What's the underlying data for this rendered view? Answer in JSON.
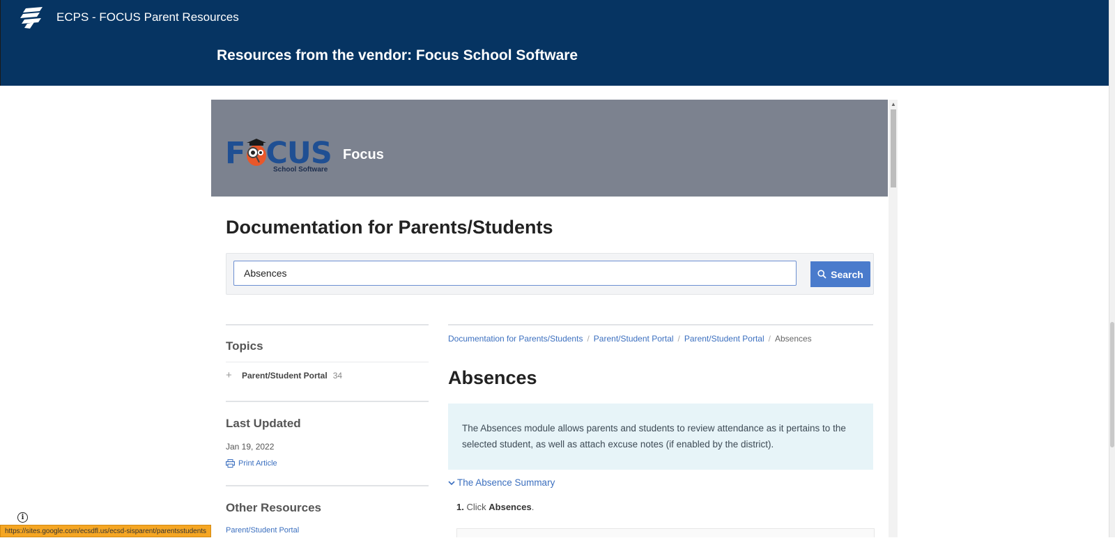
{
  "site": {
    "title": "ECPS - FOCUS Parent Resources",
    "heading": "Resources from the vendor: Focus School Software"
  },
  "focus": {
    "logo_word": "F   CUS",
    "logo_sub": "School Software",
    "name": "Focus"
  },
  "doc": {
    "title": "Documentation for Parents/Students"
  },
  "search": {
    "value": "Absences",
    "button_label": "Search"
  },
  "sidebar": {
    "topics_heading": "Topics",
    "topics": [
      {
        "label": "Parent/Student Portal",
        "count": "34"
      }
    ],
    "last_updated_heading": "Last Updated",
    "last_updated_date": "Jan 19, 2022",
    "print_label": "Print Article",
    "other_heading": "Other Resources",
    "other_link": "Parent/Student Portal"
  },
  "breadcrumb": [
    "Documentation for Parents/Students",
    "Parent/Student Portal",
    "Parent/Student Portal",
    "Absences"
  ],
  "article": {
    "title": "Absences",
    "intro": "The Absences module allows parents and students to review attendance as it pertains to the selected student, as well as attach excuse notes (if enabled by the district).",
    "section_label": "The Absence Summary",
    "step_number": "1.",
    "step_text": "Click",
    "step_bold": "Absences",
    "step_end": "."
  },
  "status_url": "https://sites.google.com/ecsdfl.us/ecsd-sisparent/parentsstudents",
  "colors": {
    "header_bg": "#063462",
    "banner_bg": "#7c828f",
    "accent": "#4a7bcc",
    "link": "#3b6fbf",
    "info_bg": "#e7f4f8"
  }
}
